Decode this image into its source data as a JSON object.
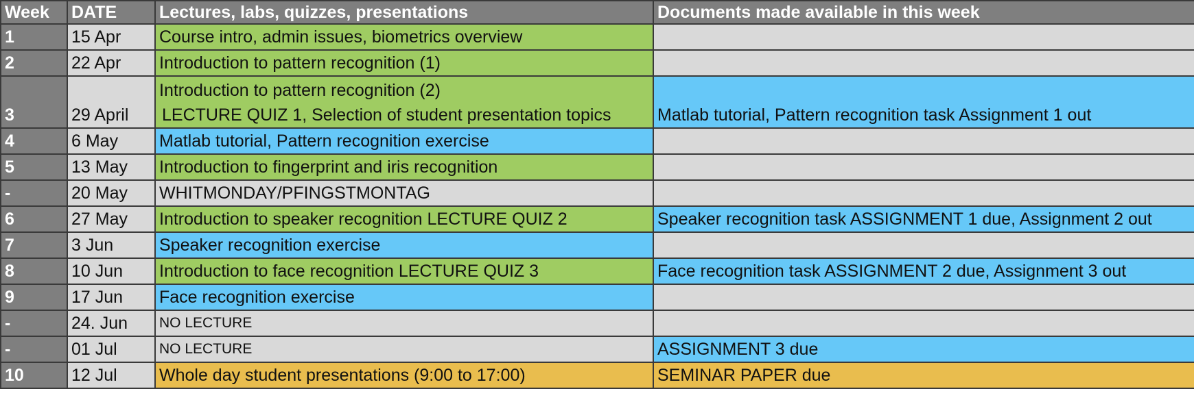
{
  "headers": {
    "week": "Week",
    "date": "DATE",
    "lectures": "Lectures, labs, quizzes, presentations",
    "documents": "Documents made available in this week"
  },
  "rows": [
    {
      "week": "1",
      "date": "15 Apr",
      "lecture": "Course intro, admin issues, biometrics overview",
      "documents": ""
    },
    {
      "week": "2",
      "date": "22 Apr",
      "lecture": "Introduction to pattern recognition (1)",
      "documents": ""
    },
    {
      "week": "3",
      "date": "29 April",
      "lecture_line1": "Introduction to pattern recognition (2)",
      "lecture_line2": "LECTURE QUIZ 1,  Selection of student presentation topics",
      "documents": "Matlab tutorial, Pattern recognition task Assignment 1 out"
    },
    {
      "week": "4",
      "date": "6 May",
      "lecture": "Matlab tutorial, Pattern recognition exercise",
      "documents": ""
    },
    {
      "week": "5",
      "date": "13 May",
      "lecture": "Introduction to fingerprint and iris recognition",
      "documents": ""
    },
    {
      "week": "-",
      "date": "20 May",
      "lecture": "WHITMONDAY/PFINGSTMONTAG",
      "documents": ""
    },
    {
      "week": "6",
      "date": "27 May",
      "lecture": "Introduction to speaker recognition LECTURE QUIZ 2",
      "documents": "Speaker recognition task ASSIGNMENT 1 due, Assignment 2 out"
    },
    {
      "week": "7",
      "date": "3 Jun",
      "lecture": "Speaker recognition exercise",
      "documents": ""
    },
    {
      "week": "8",
      "date": "10 Jun",
      "lecture": "Introduction to face recognition LECTURE QUIZ 3",
      "documents": "Face recognition task ASSIGNMENT 2 due, Assignment 3 out"
    },
    {
      "week": "9",
      "date": "17 Jun",
      "lecture": "Face recognition exercise",
      "documents": ""
    },
    {
      "week": "-",
      "date": "24. Jun",
      "lecture": "NO LECTURE",
      "documents": ""
    },
    {
      "week": "-",
      "date": "01 Jul",
      "lecture": "NO LECTURE",
      "documents": "ASSIGNMENT 3 due"
    },
    {
      "week": "10",
      "date": "12 Jul",
      "lecture": "Whole day student presentations (9:00 to 17:00)",
      "documents": "SEMINAR PAPER due"
    }
  ],
  "colors": {
    "header": "#7f7f7f",
    "lecture": "#9fcc62",
    "exercise": "#66c8f8",
    "empty": "#d9d9d9",
    "presentation": "#e9bd4e"
  }
}
